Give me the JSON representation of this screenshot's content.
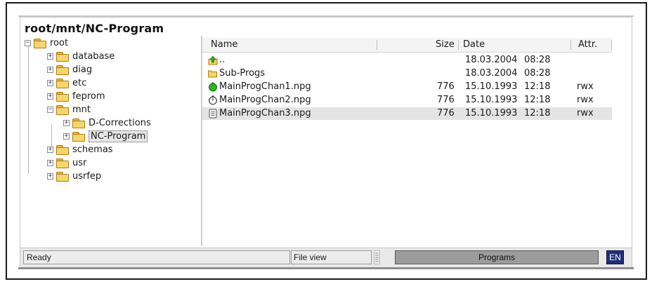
{
  "path_title": "root/mnt/NC-Program",
  "tree": [
    {
      "label": "root",
      "expander": "−"
    },
    {
      "label": "database",
      "expander": "+"
    },
    {
      "label": "diag",
      "expander": "+"
    },
    {
      "label": "etc",
      "expander": "+"
    },
    {
      "label": "feprom",
      "expander": "+"
    },
    {
      "label": "mnt",
      "expander": "−"
    },
    {
      "label": "D-Corrections",
      "expander": "+"
    },
    {
      "label": "NC-Program",
      "expander": "+"
    },
    {
      "label": "schemas",
      "expander": "+"
    },
    {
      "label": "usr",
      "expander": "+"
    },
    {
      "label": "usrfep",
      "expander": "+"
    }
  ],
  "columns": {
    "name": "Name",
    "size": "Size",
    "date": "Date",
    "attr": "Attr."
  },
  "files": [
    {
      "name": "..",
      "size": "",
      "date": "18.03.2004",
      "time": "08:28",
      "attr": "",
      "icon": "up-folder-icon"
    },
    {
      "name": "Sub-Progs",
      "size": "",
      "date": "18.03.2004",
      "time": "08:28",
      "attr": "",
      "icon": "folder-icon"
    },
    {
      "name": "MainProgChan1.npg",
      "size": "776",
      "date": "15.10.1993",
      "time": "12:18",
      "attr": "rwx",
      "icon": "program-active-icon"
    },
    {
      "name": "MainProgChan2.npg",
      "size": "776",
      "date": "15.10.1993",
      "time": "12:18",
      "attr": "rwx",
      "icon": "program-stopwatch-icon"
    },
    {
      "name": "MainProgChan3.npg",
      "size": "776",
      "date": "15.10.1993",
      "time": "12:18",
      "attr": "rwx",
      "icon": "program-file-icon"
    }
  ],
  "status": {
    "ready": "Ready",
    "view": "File view",
    "programs": "Programs",
    "lang": "EN"
  },
  "colors": {
    "selected_row": "#e4e4e4",
    "programs_bg": "#9c9c9c",
    "lang_bg": "#1f2f7a",
    "folder": "#f6d56a"
  }
}
